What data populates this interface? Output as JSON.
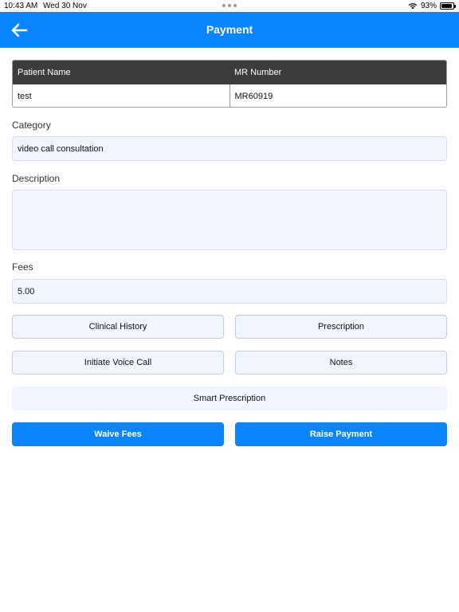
{
  "status_bar": {
    "time": "10:43 AM",
    "date": "Wed 30 Nov",
    "battery": "93%",
    "battery_level": 0.93
  },
  "header": {
    "title": "Payment",
    "back_icon": "arrow-left-icon"
  },
  "patient_table": {
    "columns": [
      "Patient Name",
      "MR Number"
    ],
    "row": [
      "test",
      "MR60919"
    ]
  },
  "category": {
    "label": "Category",
    "value": "video call consultation"
  },
  "description": {
    "label": "Description",
    "value": ""
  },
  "fees": {
    "label": "Fees",
    "value": "5.00"
  },
  "actions": {
    "clinical_history": "Clinical History",
    "prescription": "Prescription",
    "initiate_voice_call": "Initiate Voice Call",
    "notes": "Notes",
    "smart_prescription": "Smart Prescription",
    "waive_fees": "Waive Fees",
    "raise_payment": "Raise Payment"
  },
  "colors": {
    "primary": "#0a84ff",
    "table_header": "#3c3c3c",
    "field_bg": "#f0f5ff"
  }
}
